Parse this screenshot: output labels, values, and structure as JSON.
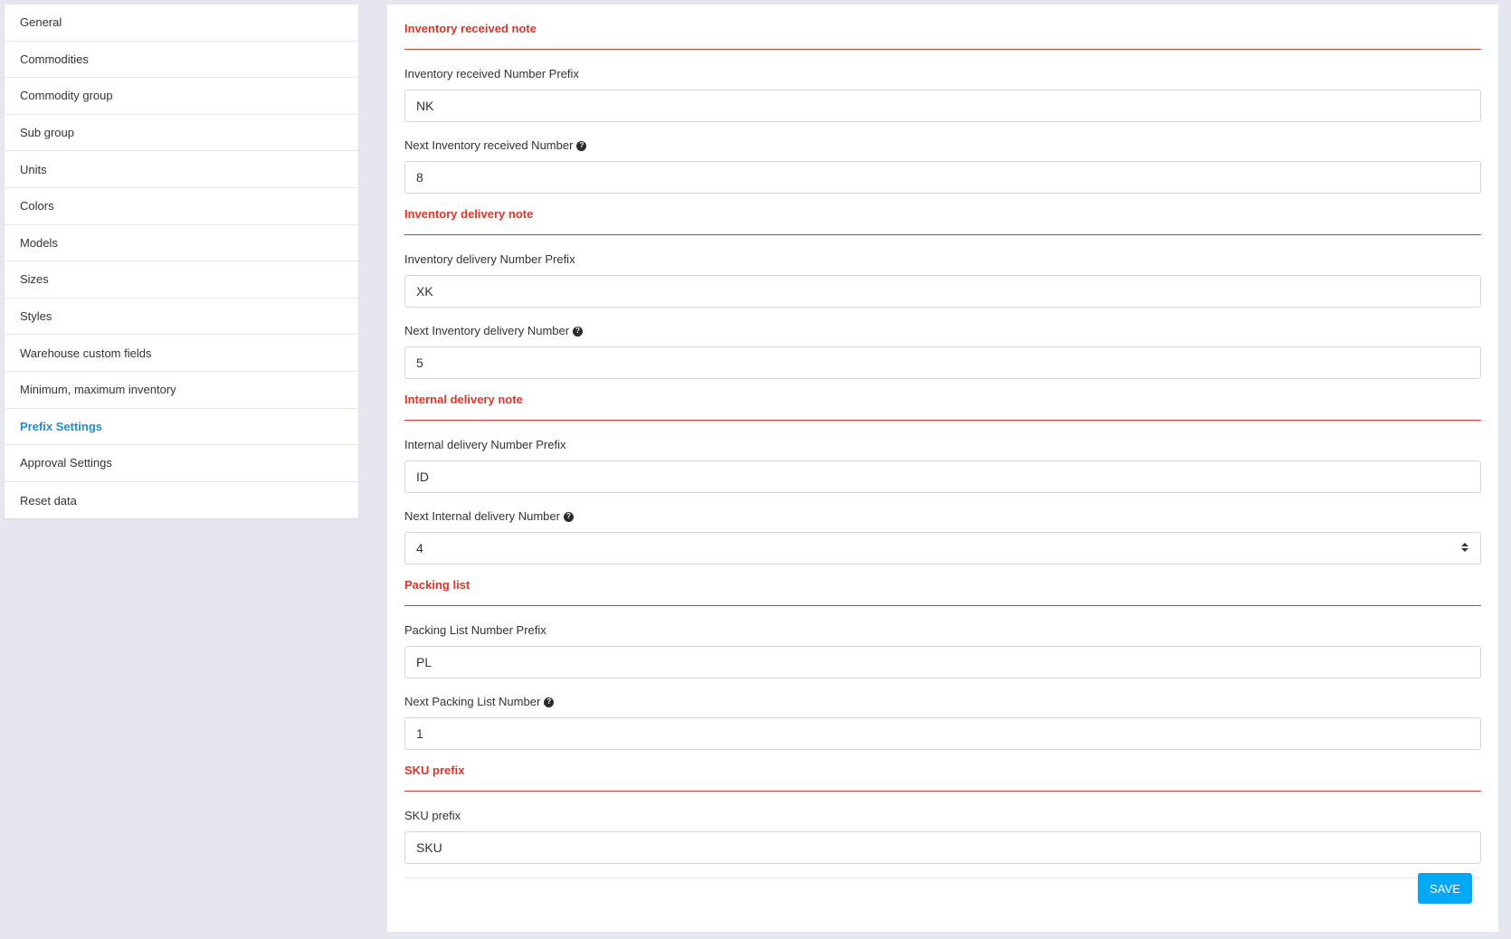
{
  "sidebar": {
    "items": [
      {
        "label": "General"
      },
      {
        "label": "Commodities"
      },
      {
        "label": "Commodity group"
      },
      {
        "label": "Sub group"
      },
      {
        "label": "Units"
      },
      {
        "label": "Colors"
      },
      {
        "label": "Models"
      },
      {
        "label": "Sizes"
      },
      {
        "label": "Styles"
      },
      {
        "label": "Warehouse custom fields"
      },
      {
        "label": "Minimum, maximum inventory"
      },
      {
        "label": "Prefix Settings",
        "active": true
      },
      {
        "label": "Approval Settings"
      },
      {
        "label": "Reset data"
      }
    ]
  },
  "sections": [
    {
      "title": "Inventory received note",
      "fields": [
        {
          "label": "Inventory received Number Prefix",
          "value": "NK",
          "help": false
        },
        {
          "label": "Next Inventory received Number",
          "value": "8",
          "help": true
        }
      ]
    },
    {
      "title": "Inventory delivery note",
      "fields": [
        {
          "label": "Inventory delivery Number Prefix",
          "value": "XK",
          "help": false
        },
        {
          "label": "Next Inventory delivery Number",
          "value": "5",
          "help": true
        }
      ]
    },
    {
      "title": "Internal delivery note",
      "fields": [
        {
          "label": "Internal delivery Number Prefix",
          "value": "ID",
          "help": false
        },
        {
          "label": "Next Internal delivery Number",
          "value": "4",
          "help": true,
          "spinner": true
        }
      ]
    },
    {
      "title": "Packing list",
      "fields": [
        {
          "label": "Packing List Number Prefix",
          "value": "PL",
          "help": false
        },
        {
          "label": "Next Packing List Number",
          "value": "1",
          "help": true
        }
      ]
    },
    {
      "title": "SKU prefix",
      "fields": [
        {
          "label": "SKU prefix",
          "value": "SKU",
          "help": false
        }
      ]
    }
  ],
  "save_label": "SAVE",
  "colors": {
    "accent": "#d9352a",
    "active_link": "#1f8cd0",
    "save_button": "#03a9f4",
    "background": "#e4e8ee"
  },
  "icons": {
    "help": "question-circle-icon",
    "spinner": "spinner-arrows-icon"
  }
}
